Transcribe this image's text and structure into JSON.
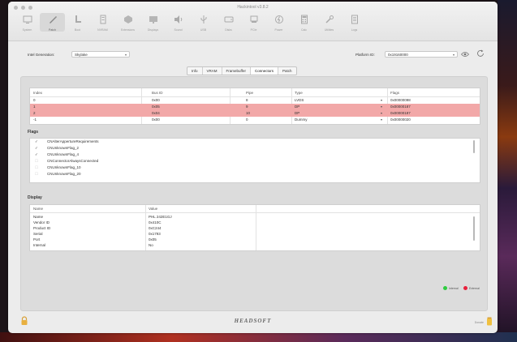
{
  "window": {
    "title": "Hackintool v3.8.2"
  },
  "toolbar": {
    "items": [
      {
        "label": "System",
        "icon": "monitor-icon"
      },
      {
        "label": "Patch",
        "icon": "pencil-icon"
      },
      {
        "label": "Boot",
        "icon": "boot-icon"
      },
      {
        "label": "NVRAM",
        "icon": "nvram-icon"
      },
      {
        "label": "Extensions",
        "icon": "extensions-icon"
      },
      {
        "label": "Displays",
        "icon": "display-icon"
      },
      {
        "label": "Sound",
        "icon": "speaker-icon"
      },
      {
        "label": "USB",
        "icon": "usb-icon"
      },
      {
        "label": "Disks",
        "icon": "disk-icon"
      },
      {
        "label": "PCIe",
        "icon": "pcie-icon"
      },
      {
        "label": "Power",
        "icon": "power-icon"
      },
      {
        "label": "Calc",
        "icon": "calculator-icon"
      },
      {
        "label": "Utilities",
        "icon": "wrench-icon"
      },
      {
        "label": "Logs",
        "icon": "logs-icon"
      }
    ],
    "active_index": 1
  },
  "intel_generation": {
    "label": "Intel Generation:",
    "value": "Skylake"
  },
  "platform_id": {
    "label": "Platform ID:",
    "value": "0x19160000"
  },
  "tabs": [
    {
      "label": "Info"
    },
    {
      "label": "VRAM"
    },
    {
      "label": "Framebuffer"
    },
    {
      "label": "Connectors"
    },
    {
      "label": "Patch"
    }
  ],
  "active_tab": 3,
  "connectors": {
    "columns": [
      "Index",
      "Bus ID",
      "Pipe",
      "Type",
      "Flags"
    ],
    "rows": [
      {
        "index": "0",
        "bus_id": "0x00",
        "pipe": "8",
        "type": "LVDS",
        "flags": "0x00000098",
        "highlight": false
      },
      {
        "index": "1",
        "bus_id": "0x05",
        "pipe": "9",
        "type": "DP",
        "flags": "0x00000187",
        "highlight": true
      },
      {
        "index": "2",
        "bus_id": "0x04",
        "pipe": "10",
        "type": "DP",
        "flags": "0x00000187",
        "highlight": true
      },
      {
        "index": "-1",
        "bus_id": "0x00",
        "pipe": "0",
        "type": "Dummy",
        "flags": "0x00000020",
        "highlight": false
      }
    ]
  },
  "flags": {
    "title": "Flags",
    "items": [
      {
        "label": "CNAlterAppertureRequirements",
        "checked": true
      },
      {
        "label": "CNUnknownFlag_2",
        "checked": true
      },
      {
        "label": "CNUnknownFlag_4",
        "checked": true
      },
      {
        "label": "CNConnectorAlwaysConnected",
        "checked": false
      },
      {
        "label": "CNUnknownFlag_10",
        "checked": false
      },
      {
        "label": "CNUnknownFlag_20",
        "checked": false
      }
    ]
  },
  "display": {
    "title": "Display",
    "columns": [
      "Name",
      "Value"
    ],
    "rows": [
      {
        "name": "Name",
        "value": "PHL 242E1GJ"
      },
      {
        "name": "Vendor ID",
        "value": "0x410C"
      },
      {
        "name": "Product ID",
        "value": "0xC244"
      },
      {
        "name": "Serial",
        "value": "0x1793"
      },
      {
        "name": "Port",
        "value": "0x05"
      },
      {
        "name": "Internal",
        "value": "No"
      }
    ]
  },
  "legend": {
    "internal": "Internal",
    "external": "External",
    "internal_color": "#2ecc40",
    "external_color": "#e8203c"
  },
  "footer": {
    "logo": "HEADSOFT",
    "donate_label": "Donate"
  }
}
